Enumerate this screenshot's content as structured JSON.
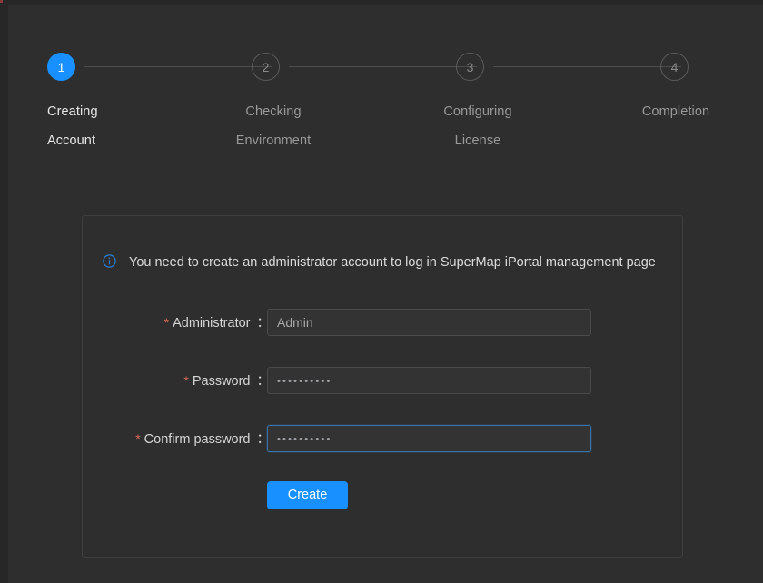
{
  "colors": {
    "background": "#2e2e2e",
    "accent": "#1890ff",
    "card_border": "#3f3f3f",
    "required_asterisk": "#d96a56",
    "focus_border": "#3a72a8"
  },
  "wizard": {
    "steps": [
      {
        "number": "1",
        "line1": "Creating",
        "line2": "Account",
        "state": "active"
      },
      {
        "number": "2",
        "line1": "Checking",
        "line2": "Environment",
        "state": "inactive"
      },
      {
        "number": "3",
        "line1": "Configuring",
        "line2": "License",
        "state": "inactive"
      },
      {
        "number": "4",
        "line1": "Completion",
        "line2": "",
        "state": "inactive"
      }
    ]
  },
  "card": {
    "notice": {
      "icon": "info-circle-icon",
      "text": "You need to create an administrator account to log in SuperMap iPortal management page"
    },
    "form": {
      "fields": [
        {
          "label": "Administrator",
          "required_marker": "*",
          "colon": "：",
          "value": "Admin",
          "type": "text",
          "focused": false
        },
        {
          "label": "Password",
          "required_marker": "*",
          "colon": "：",
          "value": "••••••••••",
          "type": "password",
          "focused": false
        },
        {
          "label": "Confirm password",
          "required_marker": "*",
          "colon": "：",
          "value": "••••••••••",
          "type": "password",
          "focused": true
        }
      ],
      "submit_label": "Create"
    }
  }
}
